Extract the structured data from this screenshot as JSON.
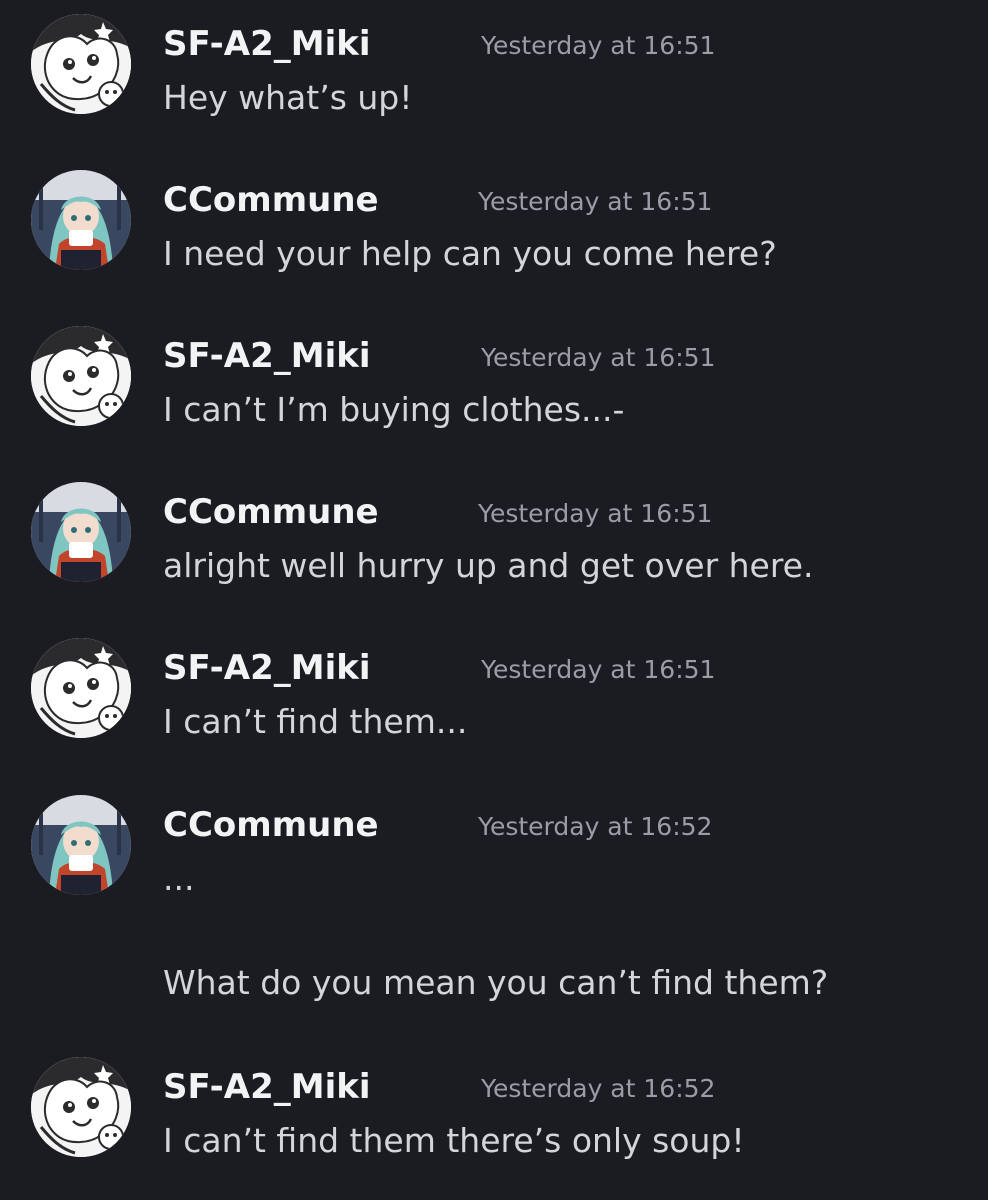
{
  "messages": [
    {
      "author": "SF-A2_Miki",
      "avatar": "miki-avatar",
      "timestamp": "Yesterday at 16:51",
      "lines": [
        "Hey what’s up!"
      ]
    },
    {
      "author": "CCommune",
      "avatar": "ccommune-avatar",
      "timestamp": "Yesterday at 16:51",
      "lines": [
        "I need your help can you come here?"
      ]
    },
    {
      "author": "SF-A2_Miki",
      "avatar": "miki-avatar",
      "timestamp": "Yesterday at 16:51",
      "lines": [
        "I can’t I’m buying clothes...-"
      ]
    },
    {
      "author": "CCommune",
      "avatar": "ccommune-avatar",
      "timestamp": "Yesterday at 16:51",
      "lines": [
        "alright well hurry up and get over here."
      ]
    },
    {
      "author": "SF-A2_Miki",
      "avatar": "miki-avatar",
      "timestamp": "Yesterday at 16:51",
      "lines": [
        "I can’t find them..."
      ]
    },
    {
      "author": "CCommune",
      "avatar": "ccommune-avatar",
      "timestamp": "Yesterday at 16:52",
      "lines": [
        "...",
        "What do you mean you can’t find them?"
      ]
    },
    {
      "author": "SF-A2_Miki",
      "avatar": "miki-avatar",
      "timestamp": "Yesterday at 16:52",
      "lines": [
        "I can’t find them there’s only soup!"
      ]
    }
  ],
  "colors": {
    "background": "#1b1c22",
    "username": "#f2f3f5",
    "timestamp": "#9a9ca6",
    "message_text": "#d4d5da"
  }
}
